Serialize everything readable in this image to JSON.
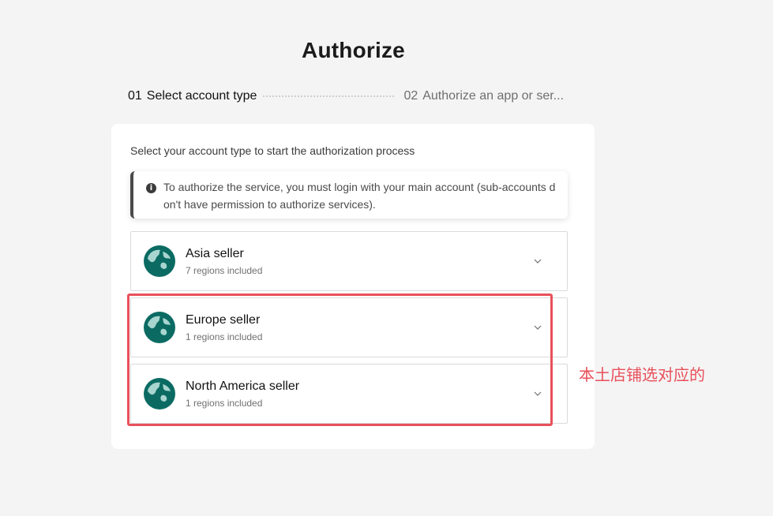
{
  "page": {
    "title": "Authorize"
  },
  "steps": [
    {
      "number": "01",
      "label": "Select account type",
      "state": "active"
    },
    {
      "number": "02",
      "label": "Authorize an app or ser...",
      "state": "inactive"
    }
  ],
  "card": {
    "subtitle": "Select your account type to start the authorization process",
    "notice": {
      "icon": "info-icon",
      "text": "To authorize the service, you must login with your main account (sub-accounts don't have permission to authorize services)."
    },
    "sellers": [
      {
        "name": "Asia seller",
        "regions": "7 regions included",
        "icon": "globe-icon"
      },
      {
        "name": "Europe seller",
        "regions": "1 regions included",
        "icon": "globe-icon"
      },
      {
        "name": "North America seller",
        "regions": "1 regions included",
        "icon": "globe-icon"
      }
    ]
  },
  "annotation": {
    "text": "本土店铺选对应的",
    "color": "#e8505b"
  },
  "colors": {
    "globe_bg": "#0b6b63",
    "globe_land": "#a8d5cf",
    "highlight": "#e8505b",
    "page_bg": "#f4f4f4"
  }
}
